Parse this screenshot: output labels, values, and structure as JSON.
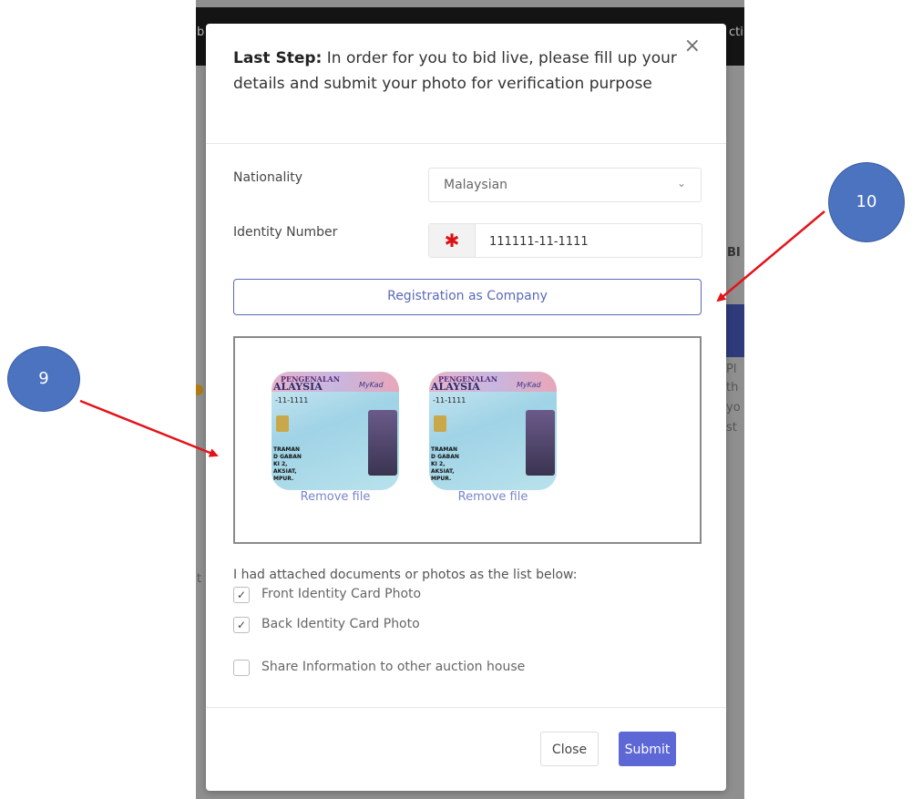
{
  "background": {
    "top_text_left": "b",
    "top_text_right": "cti",
    "side_text_bi": "BI",
    "side_text_lines": [
      "Pl",
      "th",
      "yo",
      "st"
    ],
    "left_partial_text": "t"
  },
  "modal": {
    "close_icon": "×",
    "header_bold": "Last Step:",
    "header_text": " In order for you to bid live, please fill up your details and submit your photo for verification purpose",
    "nationality_label": "Nationality",
    "nationality_value": "Malaysian",
    "identity_label": "Identity Number",
    "identity_required_mark": "✱",
    "identity_value": "111111-11-1111",
    "company_button": "Registration as Company",
    "uploads": [
      {
        "card_header": "PENGENALAN",
        "card_country": "ALAYSIA",
        "card_brand": "MyKad",
        "card_number": "-11-1111",
        "card_lines": [
          "TRAMAN",
          "D GABAN",
          "KI 2,",
          "AKSIAT,",
          "MPUR."
        ],
        "remove_label": "Remove file"
      },
      {
        "card_header": "PENGENALAN",
        "card_country": "ALAYSIA",
        "card_brand": "MyKad",
        "card_number": "-11-1111",
        "card_lines": [
          "TRAMAN",
          "D GABAN",
          "KI 2,",
          "AKSIAT,",
          "MPUR."
        ],
        "remove_label": "Remove file"
      }
    ],
    "docs_title": "I had attached documents or photos as the list below:",
    "checkboxes": [
      {
        "label": "Front Identity Card Photo",
        "mark": "✓"
      },
      {
        "label": "Back Identity Card Photo",
        "mark": "✓"
      },
      {
        "label": "Share Information to other auction house",
        "mark": ""
      }
    ],
    "close_button": "Close",
    "submit_button": "Submit"
  },
  "annotations": {
    "left_number": "9",
    "right_number": "10",
    "arrow_color": "#e3141b",
    "circle_color": "#4c73c0"
  }
}
